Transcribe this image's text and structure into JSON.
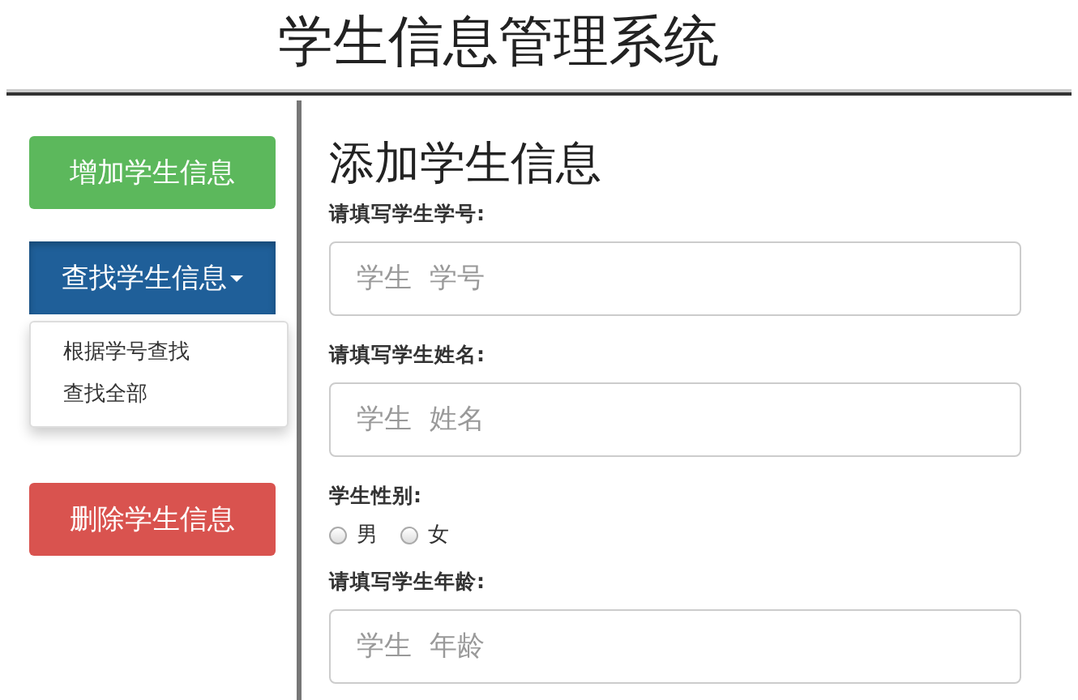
{
  "header": {
    "title": "学生信息管理系统"
  },
  "sidebar": {
    "buttons": [
      {
        "label": "增加学生信息",
        "color": "#5cb85c"
      },
      {
        "label": "查找学生信息",
        "color": "#1f5f99",
        "expanded": true,
        "menu": [
          "根据学号查找",
          "查找全部"
        ]
      },
      {
        "label": "删除学生信息",
        "color": "#d9534f"
      }
    ]
  },
  "form": {
    "heading": "添加学生信息",
    "fields": [
      {
        "kind": "text",
        "label": "请填写学生学号:",
        "placeholder": "学生  学号"
      },
      {
        "kind": "text",
        "label": "请填写学生姓名:",
        "placeholder": "学生  姓名"
      },
      {
        "kind": "radio",
        "label": "学生性别:",
        "options": [
          {
            "label": "男",
            "selected": false
          },
          {
            "label": "女",
            "selected": false
          }
        ]
      },
      {
        "kind": "text",
        "label": "请填写学生年龄:",
        "placeholder": "学生  年龄"
      }
    ]
  }
}
